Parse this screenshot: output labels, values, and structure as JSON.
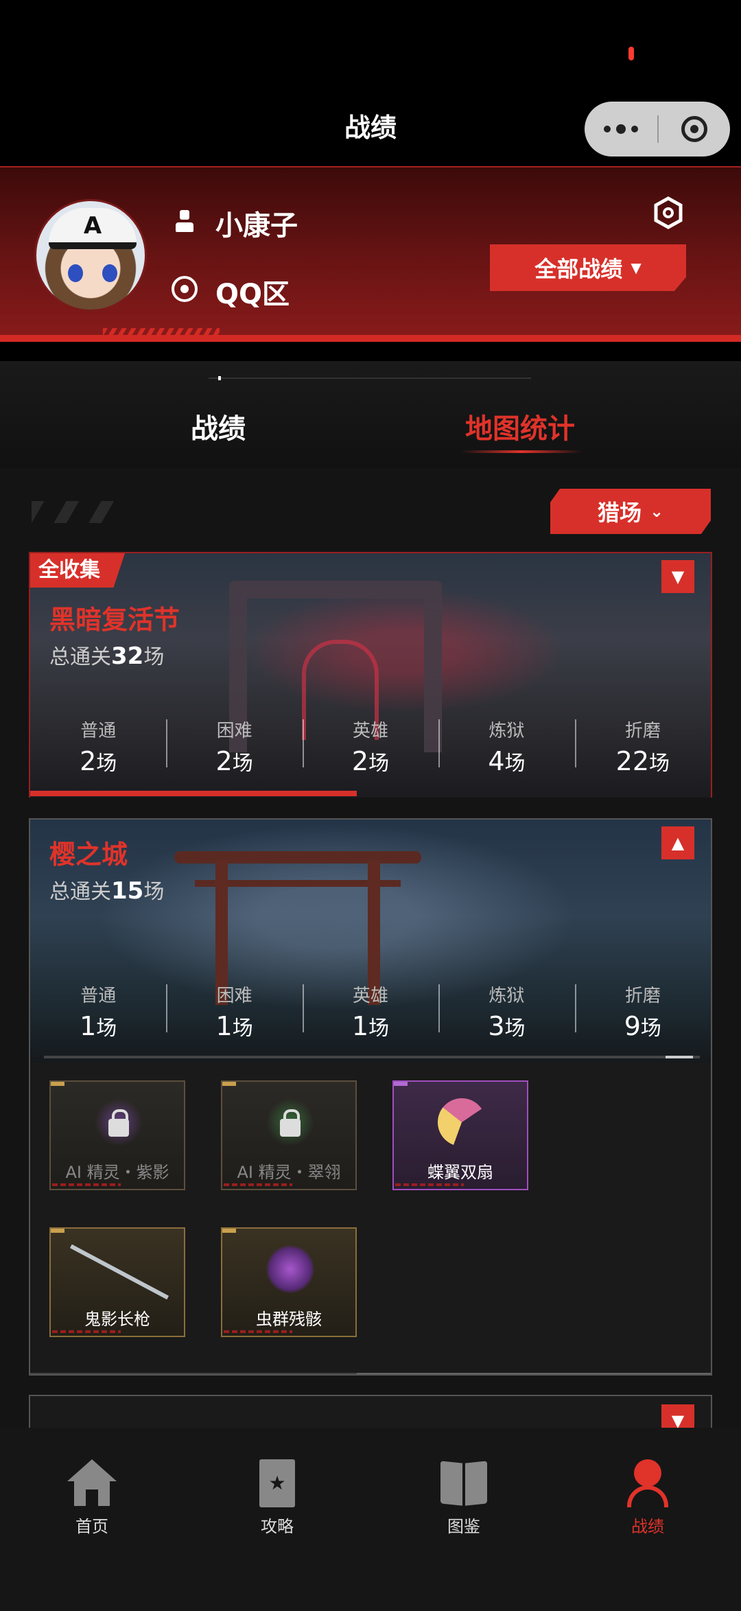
{
  "nav": {
    "title": "战绩"
  },
  "profile": {
    "username": "小康子",
    "region": "QQ区",
    "all_records_label": "全部战绩"
  },
  "tabs": [
    {
      "label": "战绩"
    },
    {
      "label": "地图统计"
    }
  ],
  "filter": {
    "label": "猎场"
  },
  "maps": [
    {
      "badge": "全收集",
      "name": "黑暗复活节",
      "total_prefix": "总通关",
      "total_count": "32",
      "total_suffix": "场",
      "stats": [
        {
          "label": "普通",
          "count": "2",
          "unit": "场"
        },
        {
          "label": "困难",
          "count": "2",
          "unit": "场"
        },
        {
          "label": "英雄",
          "count": "2",
          "unit": "场"
        },
        {
          "label": "炼狱",
          "count": "4",
          "unit": "场"
        },
        {
          "label": "折磨",
          "count": "22",
          "unit": "场"
        }
      ],
      "expanded": false
    },
    {
      "name": "樱之城",
      "total_prefix": "总通关",
      "total_count": "15",
      "total_suffix": "场",
      "stats": [
        {
          "label": "普通",
          "count": "1",
          "unit": "场"
        },
        {
          "label": "困难",
          "count": "1",
          "unit": "场"
        },
        {
          "label": "英雄",
          "count": "1",
          "unit": "场"
        },
        {
          "label": "炼狱",
          "count": "3",
          "unit": "场"
        },
        {
          "label": "折磨",
          "count": "9",
          "unit": "场"
        }
      ],
      "expanded": true,
      "items": [
        {
          "label": "AI 精灵・紫影",
          "locked": true,
          "rarity": "gold"
        },
        {
          "label": "AI 精灵・翠翎",
          "locked": true,
          "rarity": "gold"
        },
        {
          "label": "蝶翼双扇",
          "locked": false,
          "rarity": "purple"
        },
        {
          "label": "鬼影长枪",
          "locked": false,
          "rarity": "gold"
        },
        {
          "label": "虫群残骸",
          "locked": false,
          "rarity": "gold"
        }
      ]
    }
  ],
  "tabbar": [
    {
      "label": "首页",
      "icon": "home-icon"
    },
    {
      "label": "攻略",
      "icon": "guide-icon"
    },
    {
      "label": "图鉴",
      "icon": "atlas-icon"
    },
    {
      "label": "战绩",
      "icon": "record-icon",
      "active": true
    }
  ],
  "colors": {
    "accent": "#d7302a",
    "background": "#141414"
  }
}
